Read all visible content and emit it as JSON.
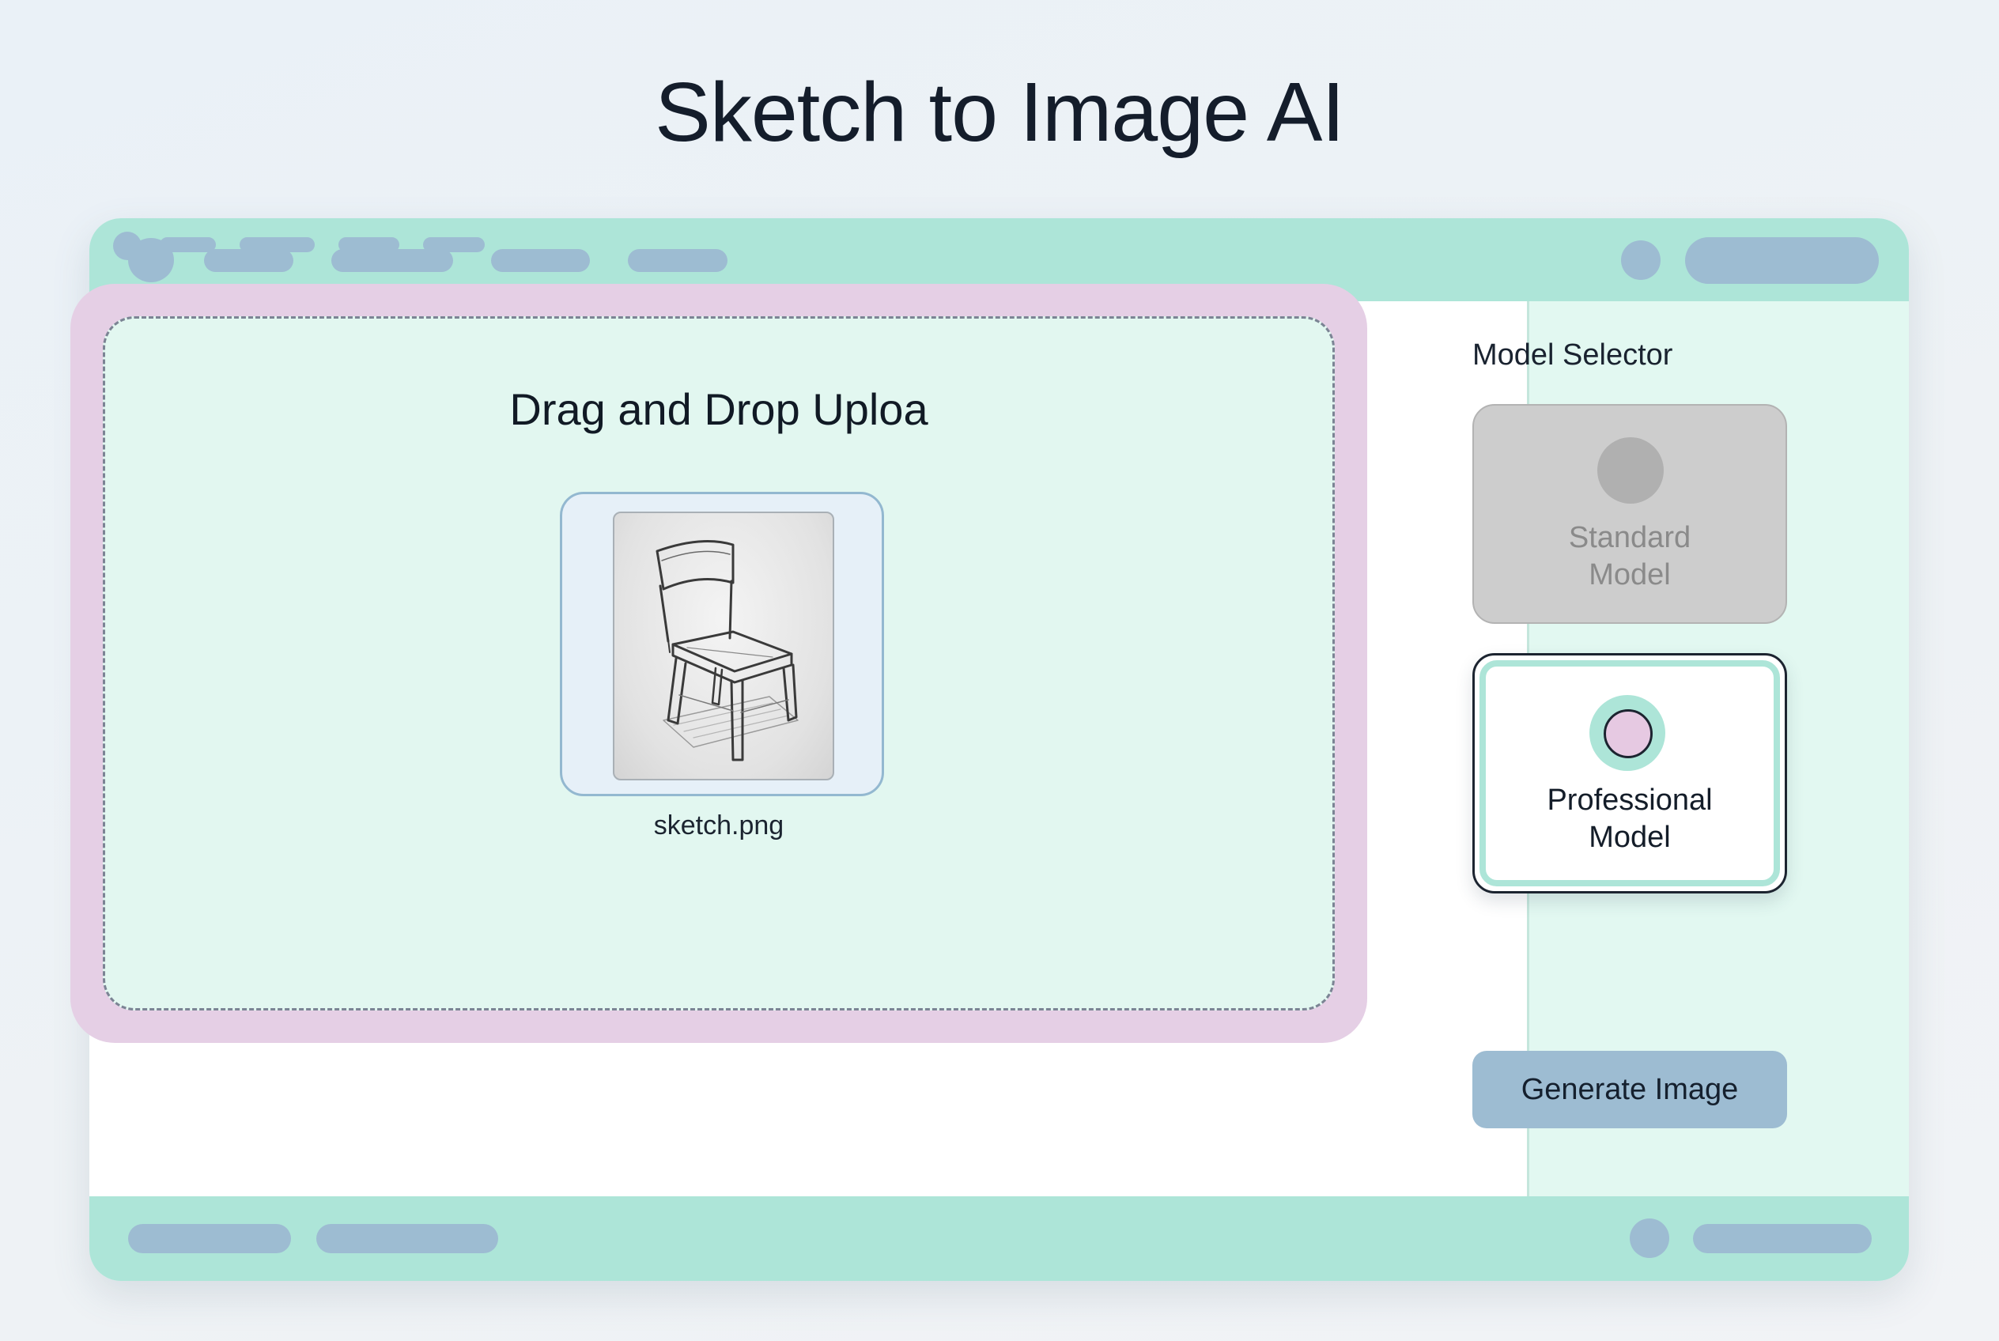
{
  "page": {
    "title": "Sketch to Image AI"
  },
  "upload": {
    "title": "Drag and Drop Uploa",
    "file_name": "sketch.png",
    "thumbnail_icon": "chair-sketch-image"
  },
  "sidebar": {
    "label": "Model Selector",
    "models": [
      {
        "label": "Standard\nModel",
        "selected": false,
        "icon": "model-circle-icon"
      },
      {
        "label": "Professional\nModel",
        "selected": true,
        "icon": "radio-selected-icon"
      }
    ],
    "generate_label": "Generate Image"
  },
  "colors": {
    "accent_mint": "#ade5d8",
    "placeholder_blue": "#9dbcd2",
    "upload_frame_lavender": "#e5cfe5",
    "sidebar_bg": "#e2f8f1"
  }
}
